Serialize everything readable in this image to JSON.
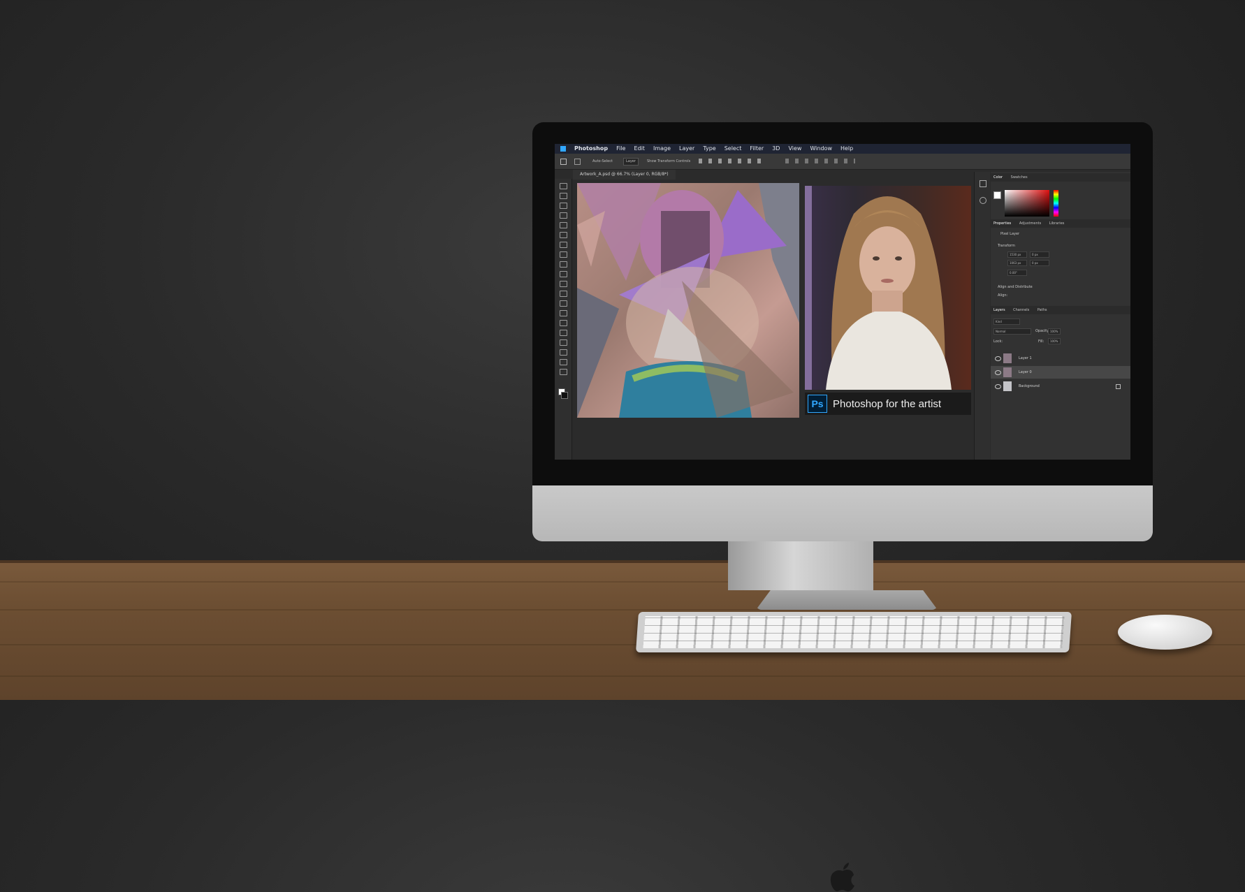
{
  "app": {
    "name": "Photoshop",
    "menu": [
      "File",
      "Edit",
      "Image",
      "Layer",
      "Type",
      "Select",
      "Filter",
      "3D",
      "View",
      "Window",
      "Help"
    ]
  },
  "options_bar": {
    "auto_select_label": "Auto-Select",
    "auto_select_target": "Layer",
    "show_transform_label": "Show Transform Controls"
  },
  "document": {
    "tab_title": "Artwork_A.psd @ 66.7% (Layer 0, RGB/8*)"
  },
  "video": {
    "badge": "Ps",
    "caption": "Photoshop for the artist"
  },
  "color_panel": {
    "tabs": [
      "Color",
      "Swatches"
    ]
  },
  "properties_panel": {
    "tabs": [
      "Properties",
      "Adjustments",
      "Libraries"
    ],
    "layer_type": "Pixel Layer",
    "transform_label": "Transform",
    "w_value": "1530 px",
    "x_value": "0 px",
    "h_value": "1063 px",
    "y_value": "0 px",
    "angle_value": "0.00°",
    "align_label": "Align and Distribute",
    "align_sub": "Align:"
  },
  "layers_panel": {
    "tabs": [
      "Layers",
      "Channels",
      "Paths"
    ],
    "kind_filter": "Kind",
    "blend_mode": "Normal",
    "opacity_label": "Opacity:",
    "opacity_value": "100%",
    "lock_label": "Lock:",
    "fill_label": "Fill:",
    "fill_value": "100%",
    "layers": [
      {
        "name": "Layer 1",
        "selected": false,
        "locked": false
      },
      {
        "name": "Layer 0",
        "selected": true,
        "locked": false
      },
      {
        "name": "Background",
        "selected": false,
        "locked": true
      }
    ]
  },
  "colors": {
    "ps_blue": "#31a8ff",
    "ps_dark": "#001e36",
    "menubar": "#1f2433"
  },
  "icons": [
    "apple-logo-icon",
    "home-icon",
    "move-tool-icon",
    "eye-icon",
    "lock-icon"
  ]
}
